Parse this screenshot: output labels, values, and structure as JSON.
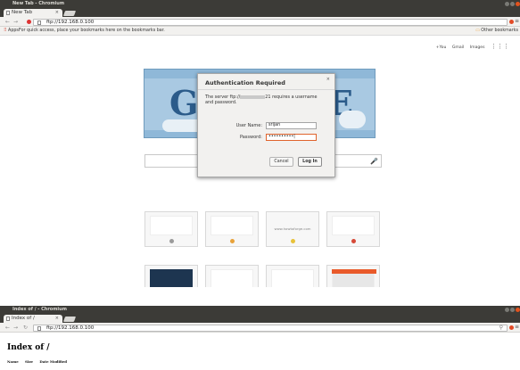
{
  "window1": {
    "title": "New Tab - Chromium",
    "tab_label": "New Tab",
    "tab_close": "×",
    "address": "ftp://192.168.0.100",
    "bookmarks": {
      "apps_label": "Apps",
      "hint": "For quick access, place your bookmarks here on the bookmarks bar.",
      "other_label": "Other bookmarks"
    },
    "ntp": {
      "links": [
        "+You",
        "Gmail",
        "Images"
      ],
      "tile_caption": "www.howtoforge.com"
    },
    "dialog": {
      "title": "Authentication Required",
      "close": "×",
      "message_prefix": "The server ftp://",
      "message_suffix": "21 requires a username and password.",
      "username_label": "User Name:",
      "username_value": "srijan",
      "password_label": "Password:",
      "password_value": "••••••••••|",
      "cancel_label": "Cancel",
      "login_label": "Log In"
    }
  },
  "window2": {
    "title": "Index of / - Chromium",
    "tab_label": "Index of /",
    "tab_close": "×",
    "address": "ftp://192.168.0.100",
    "heading": "Index of /",
    "columns": [
      "Name",
      "Size",
      "Date Modified"
    ]
  },
  "icons": {
    "apps": "⠿",
    "folder": "▭",
    "mic": "🎤",
    "menu": "≡",
    "back": "←",
    "forward": "→",
    "reload": "↻",
    "grid": "⋮⋮⋮",
    "close_x": "×"
  },
  "colors": {
    "titlebar": "#3c3b37",
    "accent_orange": "#e95a2a",
    "focus_border": "#e0632c"
  }
}
